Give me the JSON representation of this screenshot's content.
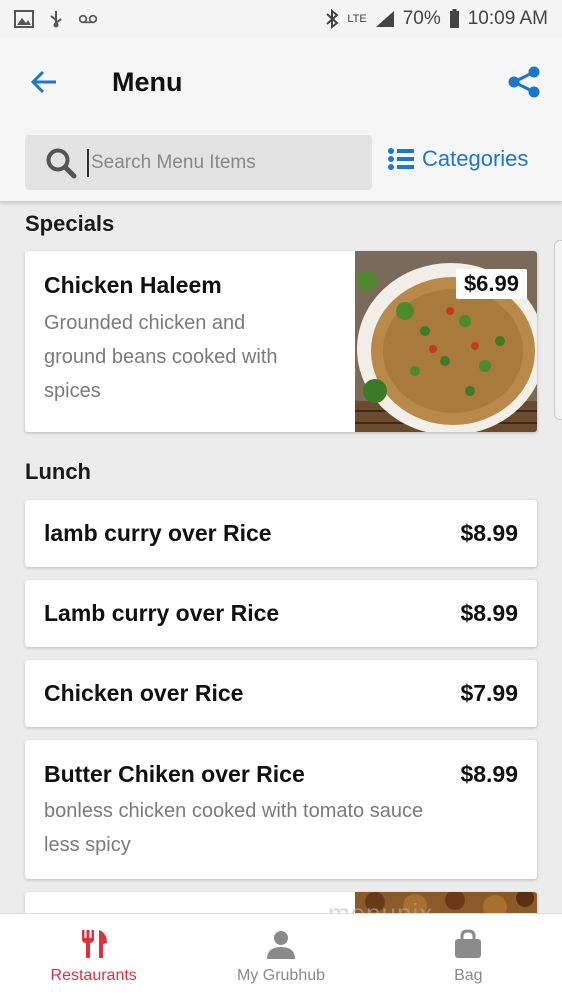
{
  "status_bar": {
    "network": "LTE",
    "battery": "70%",
    "time": "10:09 AM"
  },
  "header": {
    "title": "Menu"
  },
  "search": {
    "placeholder": "Search Menu Items",
    "categories_label": "Categories"
  },
  "sections": [
    {
      "title": "Specials",
      "items": [
        {
          "name": "Chicken Haleem",
          "description": "Grounded chicken and ground beans cooked with spices",
          "description_lines": [
            "Grounded chicken and",
            "ground beans cooked with",
            "spices"
          ],
          "price": "$6.99"
        }
      ]
    },
    {
      "title": "Lunch",
      "items": [
        {
          "name": "lamb curry over Rice",
          "price": "$8.99"
        },
        {
          "name": "Lamb curry over Rice",
          "price": "$8.99"
        },
        {
          "name": "Chicken over Rice",
          "price": "$7.99"
        },
        {
          "name": "Butter Chiken over Rice",
          "price": "$8.99",
          "description_lines": [
            "bonless chicken cooked with tomato sauce",
            "less spicy"
          ]
        }
      ]
    }
  ],
  "tabs": [
    {
      "label": "Restaurants",
      "active": true
    },
    {
      "label": "My Grubhub",
      "active": false
    },
    {
      "label": "Bag",
      "active": false
    }
  ],
  "watermark": "menupix",
  "colors": {
    "accent_blue": "#1a77c9",
    "active_red": "#d9333f",
    "background": "#ececec"
  }
}
